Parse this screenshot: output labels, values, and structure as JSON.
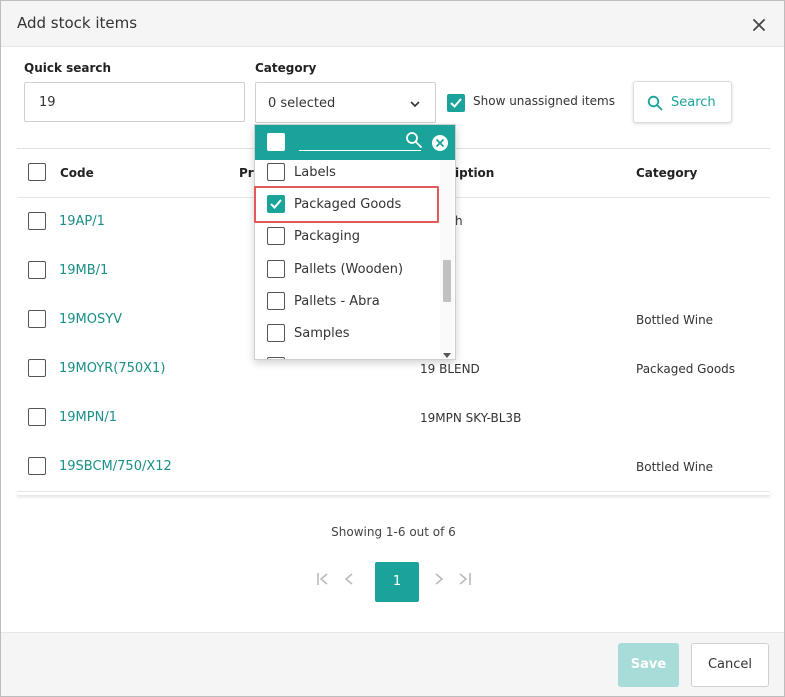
{
  "dialog": {
    "title": "Add stock items"
  },
  "filters": {
    "quick_search_label": "Quick search",
    "quick_search_value": "19",
    "category_label": "Category",
    "category_selected": "0 selected",
    "show_unassigned_label": "Show unassigned items",
    "show_unassigned_checked": true,
    "search_button": "Search"
  },
  "category_dropdown": {
    "filter_value": "",
    "options": [
      {
        "label": "Labels",
        "checked": false
      },
      {
        "label": "Packaged Goods",
        "checked": true
      },
      {
        "label": "Packaging",
        "checked": false
      },
      {
        "label": "Pallets (Wooden)",
        "checked": false
      },
      {
        "label": "Pallets - Abra",
        "checked": false
      },
      {
        "label": "Samples",
        "checked": false
      }
    ]
  },
  "table": {
    "columns": {
      "code": "Code",
      "product_partial": "Pr",
      "description_partial": "iption",
      "category": "Category"
    },
    "rows": [
      {
        "code": "19AP/1",
        "description": "h",
        "category": ""
      },
      {
        "code": "19MB/1",
        "description": "",
        "category": ""
      },
      {
        "code": "19MOSYV",
        "description": "",
        "category": "Bottled Wine"
      },
      {
        "code": "19MOYR(750X1)",
        "description": "19 BLEND",
        "category": "Packaged Goods"
      },
      {
        "code": "19MPN/1",
        "description": "19MPN SKY-BL3B",
        "category": ""
      },
      {
        "code": "19SBCM/750/X12",
        "description": "",
        "category": "Bottled Wine"
      }
    ]
  },
  "pagination": {
    "showing": "Showing 1-6 out of 6",
    "current_page": "1"
  },
  "footer": {
    "save": "Save",
    "cancel": "Cancel"
  },
  "colors": {
    "accent": "#1aa39a",
    "highlight": "#e35959"
  }
}
